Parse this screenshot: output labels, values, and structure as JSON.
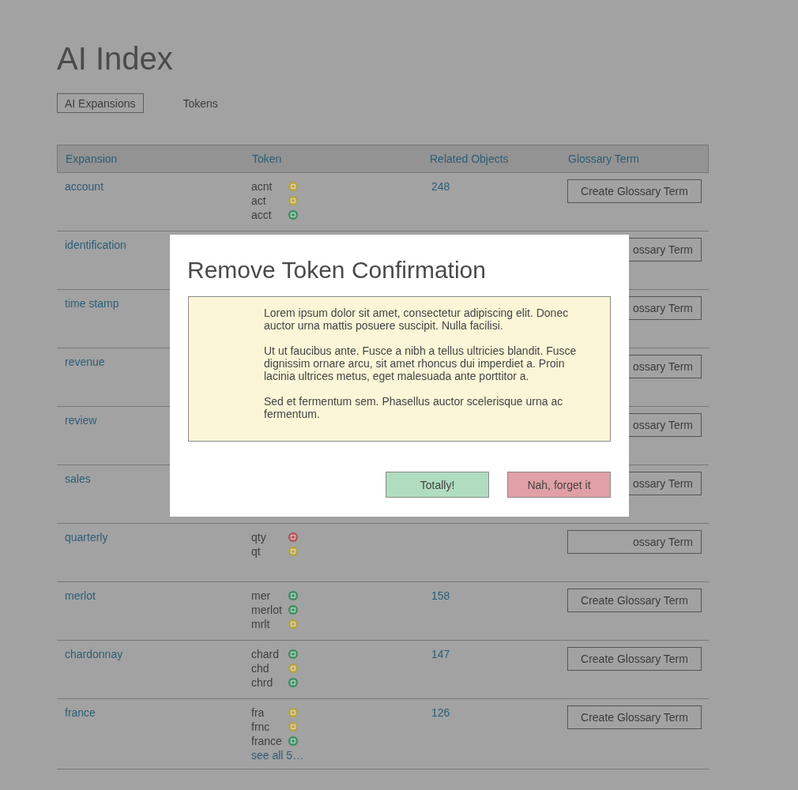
{
  "page": {
    "title": "AI Index"
  },
  "tabs": [
    {
      "label": "AI Expansions",
      "selected": true
    },
    {
      "label": "Tokens",
      "selected": false
    }
  ],
  "table": {
    "columns": [
      "Expansion",
      "Token",
      "Related Objects",
      "Glossary Term"
    ],
    "rows": [
      {
        "expansion": "account",
        "tokens": [
          {
            "text": "acnt",
            "color": "#b8a032"
          },
          {
            "text": "act",
            "color": "#b8a032"
          },
          {
            "text": "acct",
            "color": "#2e8b57"
          }
        ],
        "related": "248",
        "glossary_button": "Create Glossary Term"
      },
      {
        "expansion": "identification",
        "tokens": [],
        "glossary_button": "ossary Term"
      },
      {
        "expansion": "time stamp",
        "tokens": [],
        "glossary_button": "ossary Term"
      },
      {
        "expansion": "revenue",
        "tokens": [],
        "glossary_button": "ossary Term"
      },
      {
        "expansion": "review",
        "tokens": [],
        "glossary_button": "ossary Term"
      },
      {
        "expansion": "sales",
        "tokens": [],
        "glossary_button": "ossary Term"
      },
      {
        "expansion": "quarterly",
        "tokens": [
          {
            "text": "qty",
            "color": "#b04a4a"
          },
          {
            "text": "qt",
            "color": "#b8a032"
          }
        ],
        "glossary_button": "ossary Term"
      },
      {
        "expansion": "merlot",
        "tokens": [
          {
            "text": "mer",
            "color": "#2e8b57"
          },
          {
            "text": "merlot",
            "color": "#2e8b57"
          },
          {
            "text": "mrlt",
            "color": "#b8a032"
          }
        ],
        "related": "158",
        "glossary_button": "Create Glossary Term"
      },
      {
        "expansion": "chardonnay",
        "tokens": [
          {
            "text": "chard",
            "color": "#2e8b57"
          },
          {
            "text": "chd",
            "color": "#b8a032"
          },
          {
            "text": "chrd",
            "color": "#2e8b57"
          }
        ],
        "related": "147",
        "glossary_button": "Create Glossary Term"
      },
      {
        "expansion": "france",
        "tokens": [
          {
            "text": "fra",
            "color": "#b8a032"
          },
          {
            "text": "frnc",
            "color": "#b8a032"
          },
          {
            "text": "france",
            "color": "#2e8b57"
          }
        ],
        "see_all": "see all 5…",
        "related": "126",
        "glossary_button": "Create Glossary Term"
      }
    ]
  },
  "modal": {
    "title": "Remove Token Confirmation",
    "paragraphs": [
      "Lorem ipsum dolor sit amet, consectetur adipiscing elit. Donec auctor urna mattis posuere suscipit. Nulla facilisi.",
      "Ut ut faucibus ante. Fusce a nibh a tellus ultricies blandit. Fusce dignissim ornare arcu, sit amet rhoncus dui imperdiet a. Proin lacinia ultrices metus, eget malesuada ante porttitor a.",
      "Sed et fermentum sem. Phasellus auctor scelerisque urna ac fermentum."
    ],
    "buttons": [
      {
        "label": "Totally!",
        "kind": "confirm"
      },
      {
        "label": "Nah, forget it",
        "kind": "cancel"
      }
    ]
  }
}
